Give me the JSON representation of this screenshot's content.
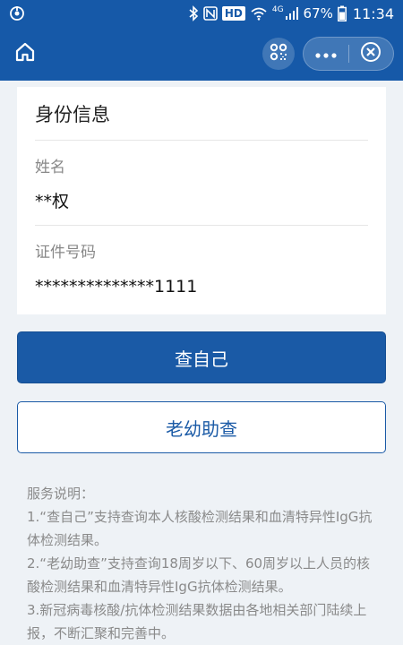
{
  "status_bar": {
    "hd": "HD",
    "network": "4G",
    "battery": "67%",
    "time": "11:34"
  },
  "nav": {
    "icons": [
      "home-icon",
      "scan-icon",
      "more-icon",
      "close-circle-icon"
    ]
  },
  "card": {
    "title": "身份信息",
    "name_label": "姓名",
    "name_value": "**权",
    "id_label": "证件号码",
    "id_value": "**************1111"
  },
  "buttons": {
    "self_check": "查自己",
    "assist_check": "老幼助查"
  },
  "notes": {
    "title": "服务说明：",
    "items": [
      "1.“查自己”支持查询本人核酸检测结果和血清特异性IgG抗体检测结果。",
      "2.“老幼助查”支持查询18周岁以下、60周岁以上人员的核酸检测结果和血清特异性IgG抗体检测结果。",
      "3.新冠病毒核酸/抗体检测结果数据由各地相关部门陆续上报，不断汇聚和完善中。"
    ]
  },
  "colors": {
    "primary": "#1a5aa6",
    "header": "#1659a8",
    "background": "#eef2f6"
  }
}
